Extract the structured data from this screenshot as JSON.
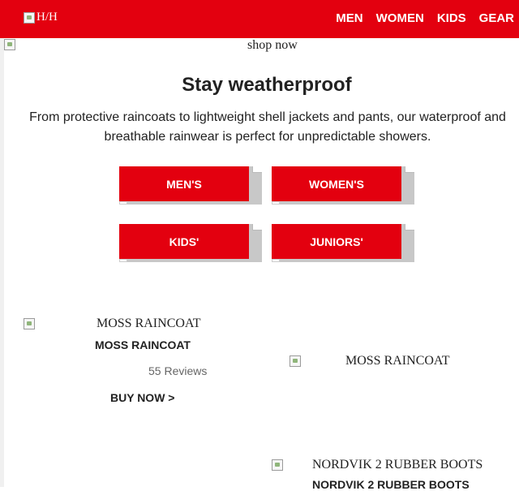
{
  "header": {
    "logo_alt": "H/H",
    "nav": [
      "MEN",
      "WOMEN",
      "KIDS",
      "GEAR"
    ]
  },
  "hero": {
    "alt": "shop now"
  },
  "intro": {
    "title": "Stay weatherproof",
    "text": "From protective raincoats to lightweight shell jackets and pants, our waterproof and breathable rainwear is perfect for unpredictable showers."
  },
  "categories": [
    "MEN'S",
    "WOMEN'S",
    "KIDS'",
    "JUNIORS'"
  ],
  "products": [
    {
      "image_alt": "MOSS RAINCOAT",
      "name": "MOSS RAINCOAT",
      "reviews": "55 Reviews",
      "cta": "BUY NOW >"
    },
    {
      "image_alt": "MOSS RAINCOAT"
    },
    {
      "image_alt": "NORDVIK 2 RUBBER BOOTS",
      "name": "NORDVIK 2 RUBBER BOOTS"
    }
  ],
  "colors": {
    "brand_red": "#e3000f",
    "shadow_gray": "#c8c8c8"
  }
}
